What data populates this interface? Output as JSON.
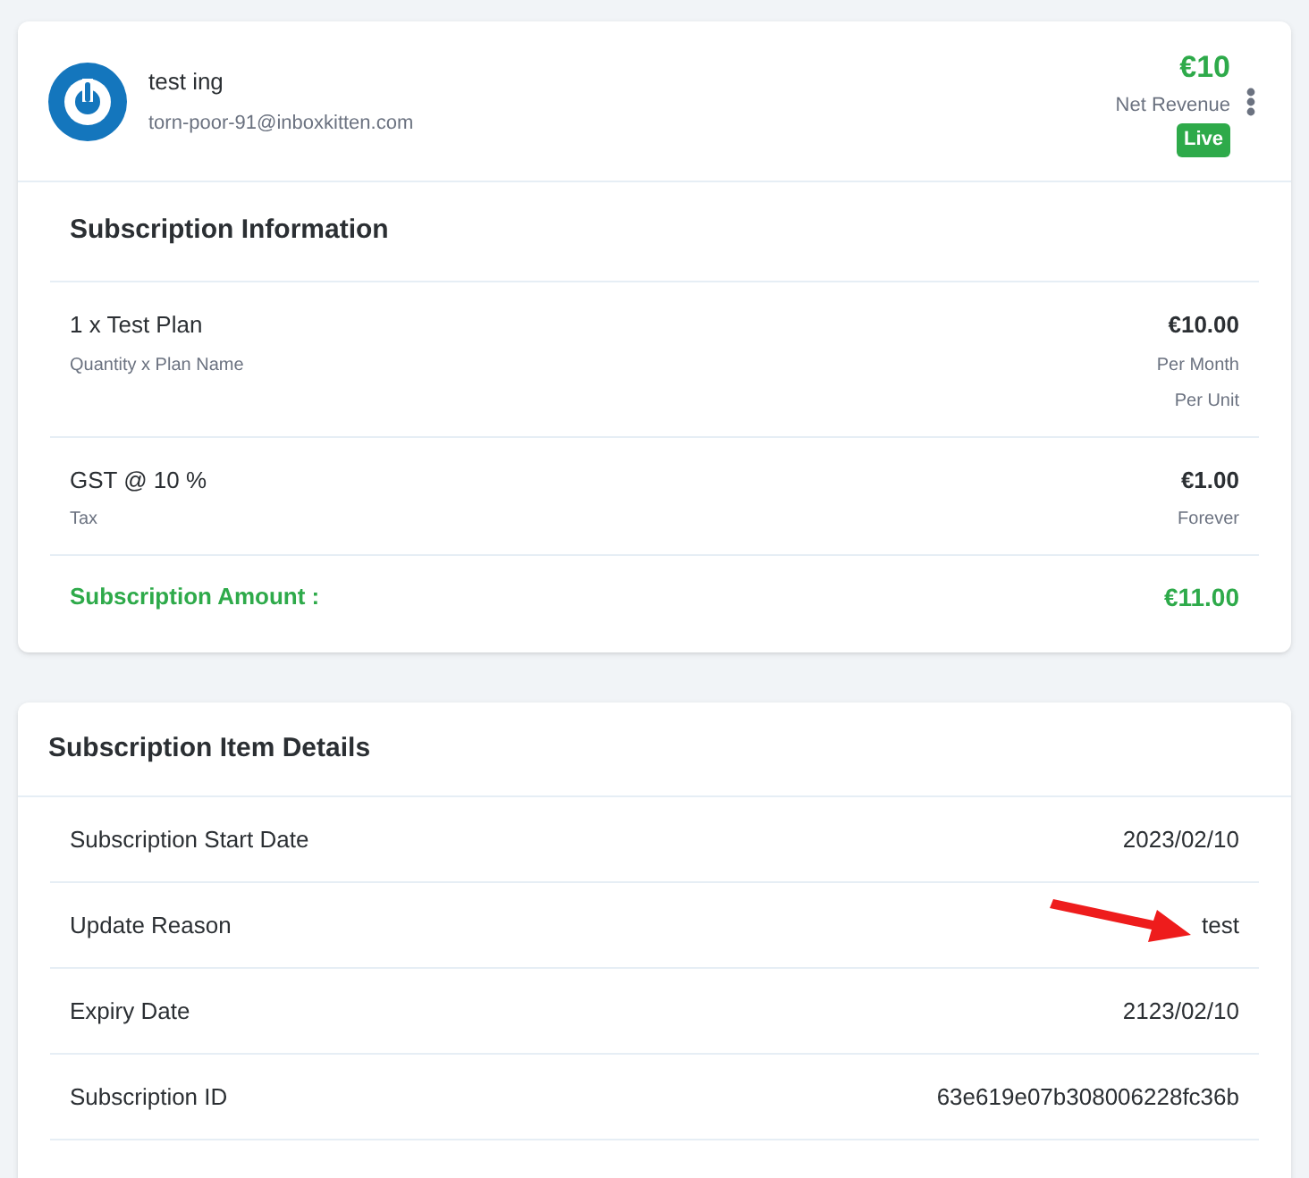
{
  "customer": {
    "name": "test ing",
    "email": "torn-poor-91@inboxkitten.com",
    "revenue": "€10",
    "revenue_label": "Net Revenue",
    "status": "Live"
  },
  "subscription_information": {
    "title": "Subscription Information",
    "lines": [
      {
        "title": "1 x Test Plan",
        "subtitle": "Quantity x Plan Name",
        "amount": "€10.00",
        "notes": [
          "Per Month",
          "Per Unit"
        ]
      },
      {
        "title": "GST @ 10 %",
        "subtitle": "Tax",
        "amount": "€1.00",
        "notes": [
          "Forever"
        ]
      }
    ],
    "total_label": "Subscription Amount :",
    "total_value": "€11.00"
  },
  "subscription_item_details": {
    "title": "Subscription Item Details",
    "rows": [
      {
        "label": "Subscription Start Date",
        "value": "2023/02/10"
      },
      {
        "label": "Update Reason",
        "value": "test"
      },
      {
        "label": "Expiry Date",
        "value": "2123/02/10"
      },
      {
        "label": "Subscription ID",
        "value": "63e619e07b308006228fc36b"
      }
    ]
  }
}
